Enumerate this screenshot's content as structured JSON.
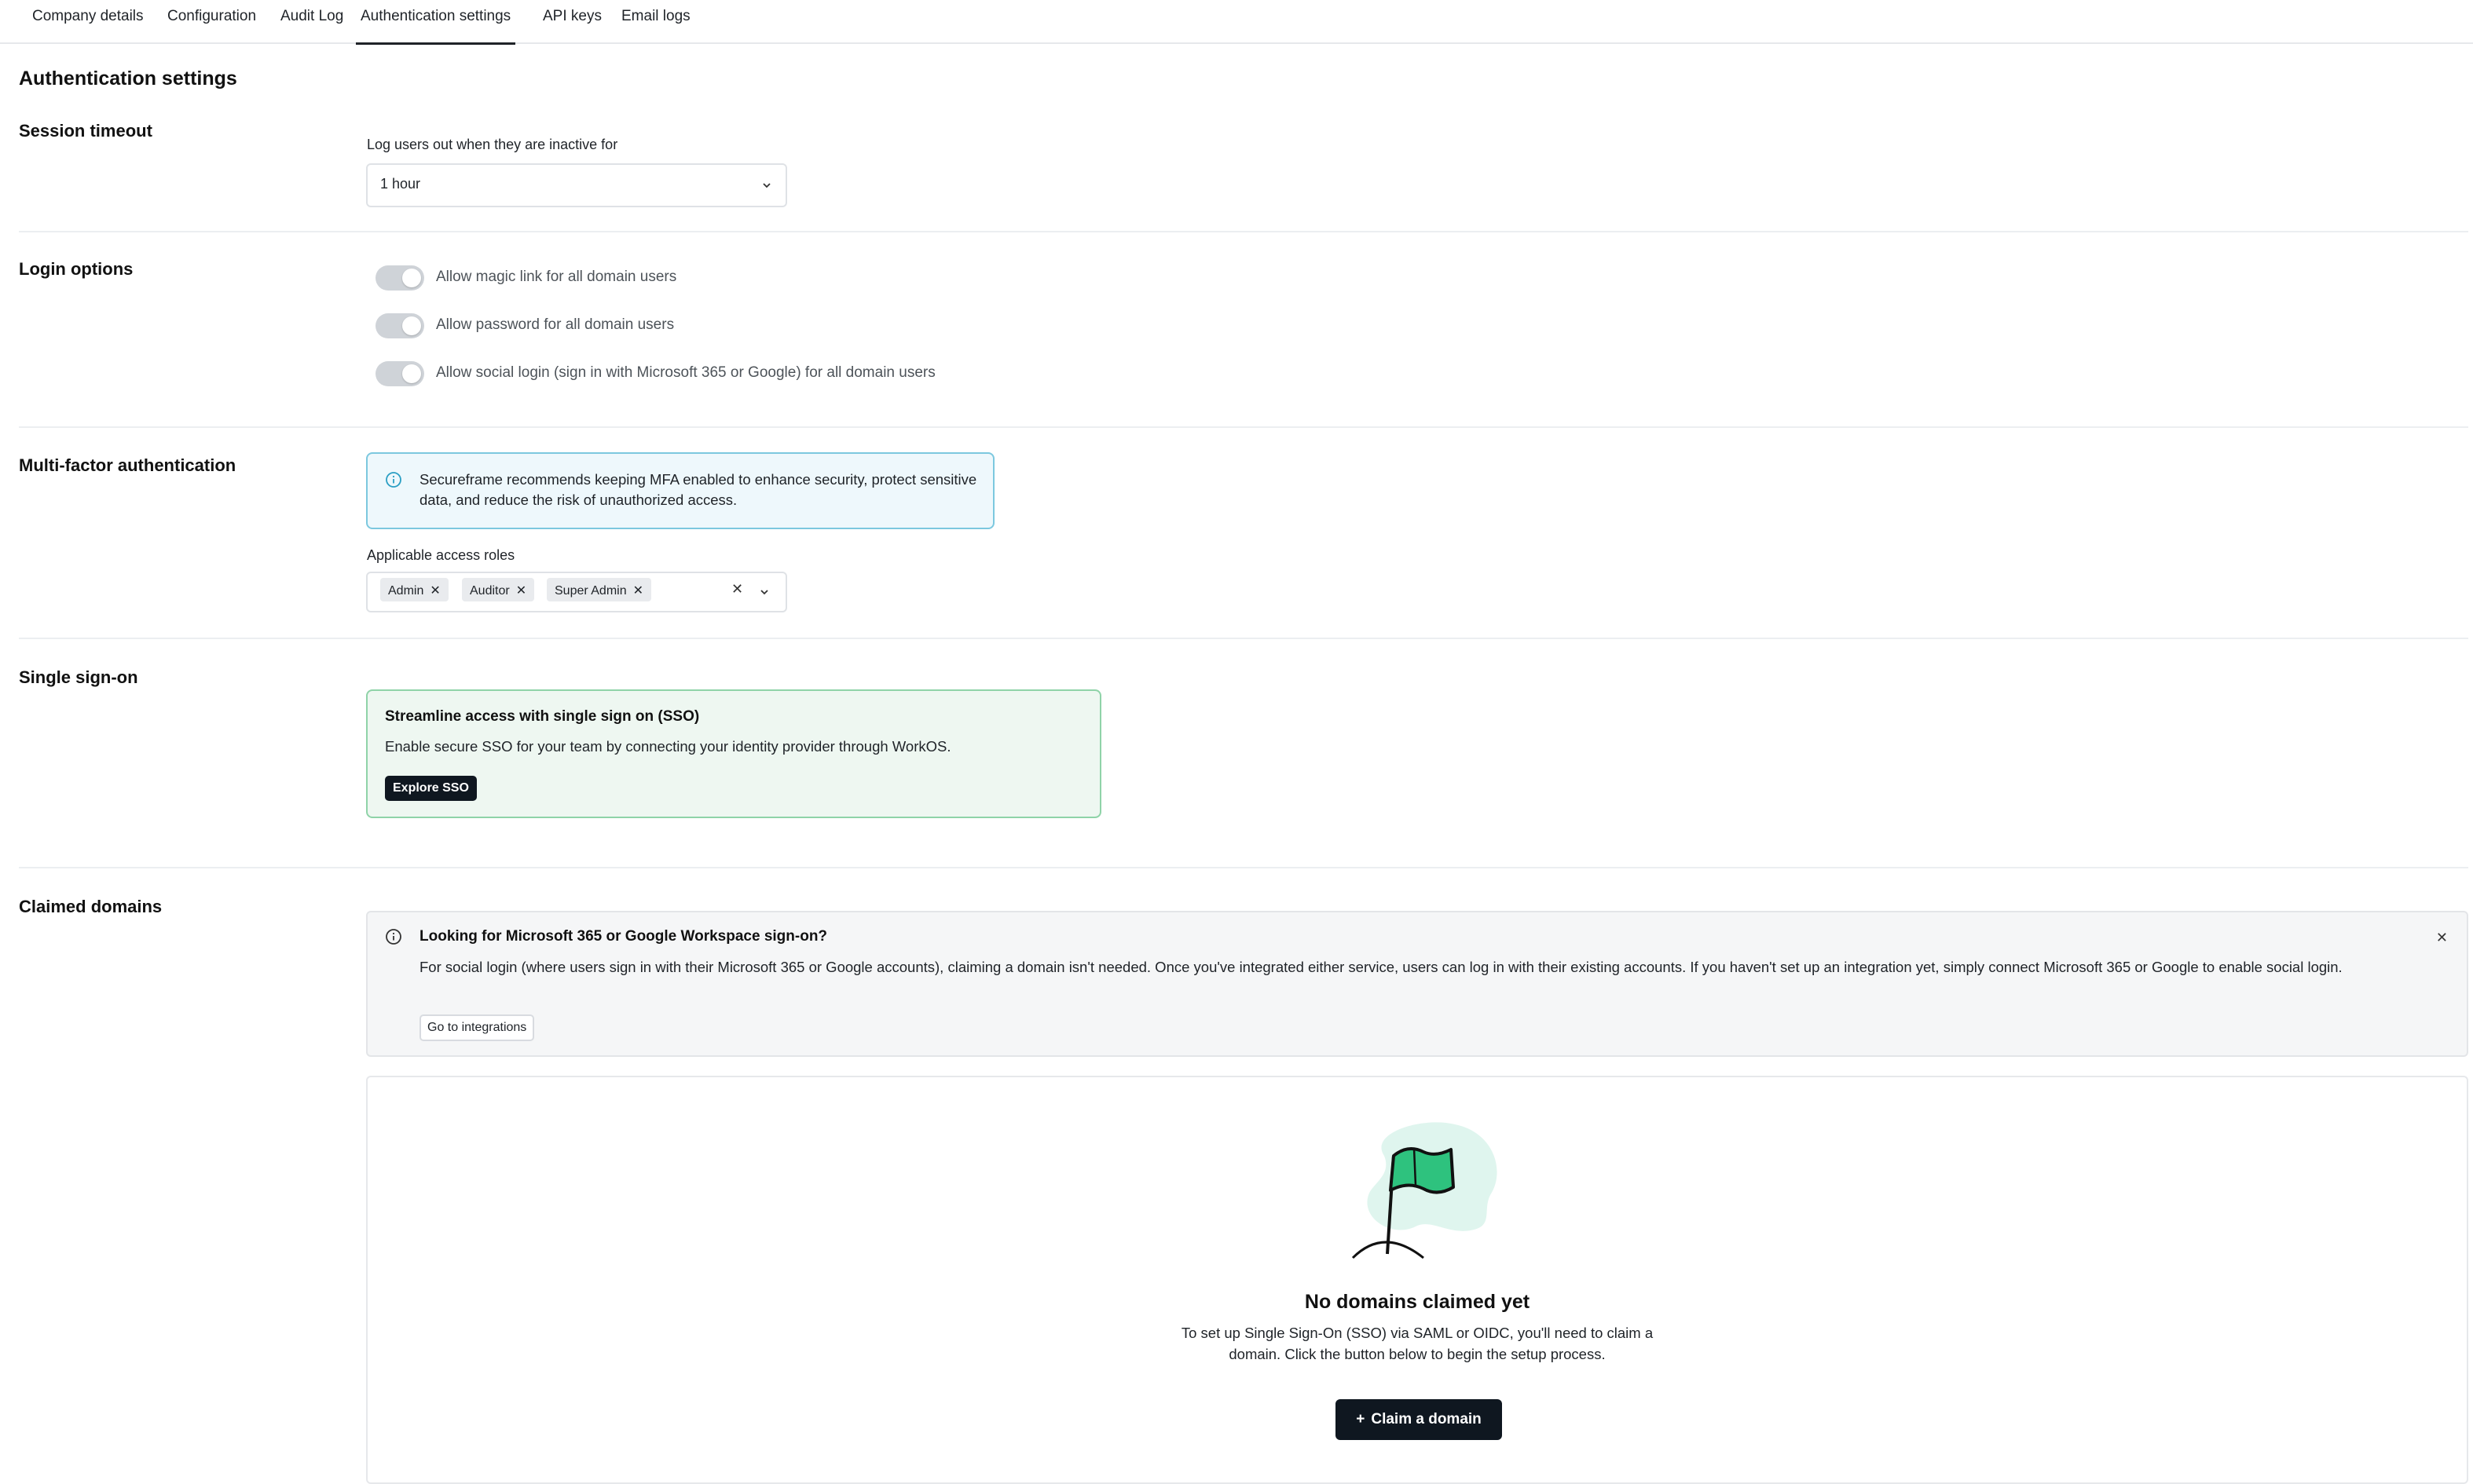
{
  "tabs": [
    {
      "label": "Company details",
      "active": false
    },
    {
      "label": "Configuration",
      "active": false
    },
    {
      "label": "Audit Log",
      "active": false
    },
    {
      "label": "Authentication settings",
      "active": true
    },
    {
      "label": "API keys",
      "active": false
    },
    {
      "label": "Email logs",
      "active": false
    }
  ],
  "page_title": "Authentication settings",
  "session_timeout": {
    "title": "Session timeout",
    "field_label": "Log users out when they are inactive for",
    "value": "1 hour"
  },
  "login_options": {
    "title": "Login options",
    "items": [
      {
        "label": "Allow magic link for all domain users",
        "enabled": true
      },
      {
        "label": "Allow password for all domain users",
        "enabled": true
      },
      {
        "label": "Allow social login (sign in with Microsoft 365 or Google) for all domain users",
        "enabled": true
      }
    ]
  },
  "mfa": {
    "title": "Multi-factor authentication",
    "info_text": "Secureframe recommends keeping MFA enabled to enhance security, protect sensitive data, and reduce the risk of unauthorized access.",
    "roles_label": "Applicable access roles",
    "roles": [
      "Admin",
      "Auditor",
      "Super Admin"
    ]
  },
  "sso": {
    "title": "Single sign-on",
    "card_title": "Streamline access with single sign on (SSO)",
    "card_text": "Enable secure SSO for your team by connecting your identity provider through WorkOS.",
    "button_label": "Explore SSO"
  },
  "claimed_domains": {
    "title": "Claimed domains",
    "banner_title": "Looking for Microsoft 365 or Google Workspace sign-on?",
    "banner_text": "For social login (where users sign in with their Microsoft 365 or Google accounts), claiming a domain isn't needed. Once you've integrated either service, users can log in with their existing accounts. If you haven't set up an integration yet, simply connect Microsoft 365 or Google to enable social login.",
    "banner_button": "Go to integrations",
    "empty_title": "No domains claimed yet",
    "empty_text": "To set up Single Sign-On (SSO) via SAML or OIDC, you'll need to claim a domain. Click the button below to begin the setup process.",
    "claim_button": "Claim a domain"
  },
  "colors": {
    "info_bg": "#eef8fc",
    "info_border": "#7cc8df",
    "sso_bg": "#eef7f1",
    "sso_border": "#8fd3a8",
    "primary_button": "#0f1720",
    "flag_green": "#2ec27e"
  },
  "icons": {
    "info": "info-circle-icon",
    "chevron": "chevron-down-icon",
    "close": "close-icon",
    "plus": "plus-icon",
    "illustration": "flag-illustration"
  }
}
